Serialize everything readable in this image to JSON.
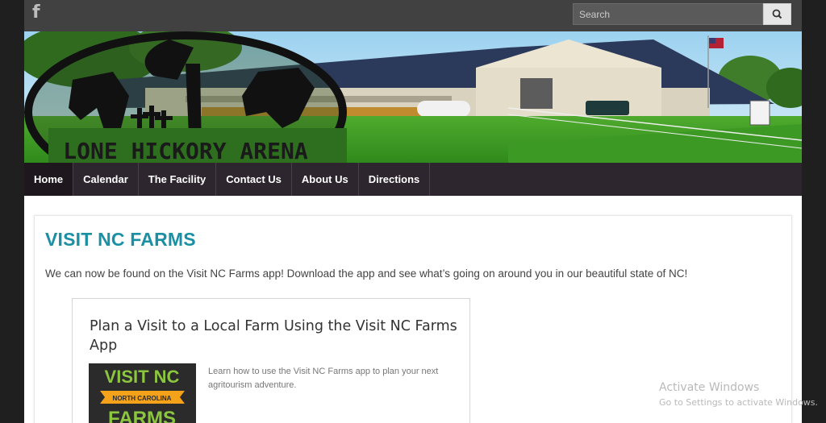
{
  "topbar": {
    "social_icon": "facebook-icon",
    "search_placeholder": "Search",
    "search_icon": "search-icon"
  },
  "banner": {
    "logo_text": "LONE HICKORY ARENA",
    "image": "arena-banner-photo"
  },
  "nav": {
    "items": [
      {
        "label": "Home",
        "active": true
      },
      {
        "label": "Calendar",
        "active": false
      },
      {
        "label": "The Facility",
        "active": false
      },
      {
        "label": "Contact Us",
        "active": false
      },
      {
        "label": "About Us",
        "active": false
      },
      {
        "label": "Directions",
        "active": false
      }
    ]
  },
  "main": {
    "title": "VISIT NC FARMS",
    "intro": "We can now be found on the Visit NC Farms app! Download the app and see what’s going on around you in our beautiful state of NC!",
    "card": {
      "title": "Plan a Visit to a Local Farm Using the Visit NC Farms App",
      "image_text_top": "VISIT NC",
      "image_ribbon": "NORTH CAROLINA",
      "image_text_bottom": "FARMS",
      "description": "Learn how to use the Visit NC Farms app to plan your next agritourism adventure."
    }
  },
  "watermark": {
    "title": "Activate Windows",
    "subtitle": "Go to Settings to activate Windows."
  },
  "colors": {
    "accent": "#1b8fa3",
    "nav_bg": "#2e262e",
    "topbar_bg": "#414141"
  }
}
